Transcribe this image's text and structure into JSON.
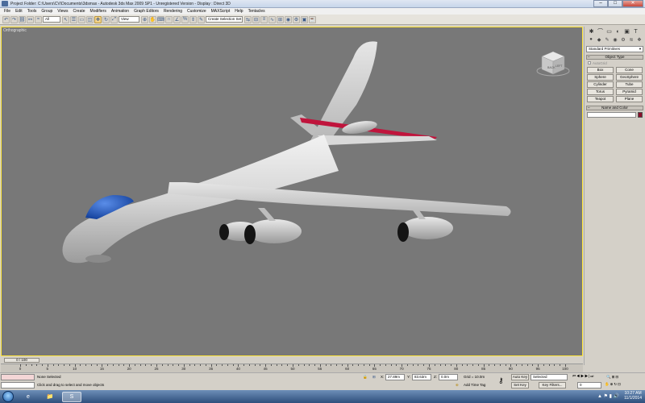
{
  "window": {
    "title": "Project Folder: C:\\Users\\CV\\Documents\\3dsmax - Autodesk 3ds Max 2009 SP1 - Unregistered Version - Display : Direct 3D",
    "buttons": {
      "minimize": "–",
      "maximize": "□",
      "close": "✕"
    }
  },
  "menu": [
    "File",
    "Edit",
    "Tools",
    "Group",
    "Views",
    "Create",
    "Modifiers",
    "Animation",
    "Graph Editors",
    "Rendering",
    "Customize",
    "MAXScript",
    "Help",
    "Tentacles"
  ],
  "toolbar": {
    "selection_filter": "All",
    "reference_coord": "View",
    "named_selection": "Create Selection Set"
  },
  "viewport": {
    "label": "Orthographic",
    "viewcube_front": "BACK",
    "viewcube_side": "LEFT"
  },
  "command_panel": {
    "tabs": [
      "✱",
      "⌒",
      "▭",
      "◐",
      "▣",
      "T"
    ],
    "category_icons": [
      "●",
      "◆",
      "✎",
      "◉",
      "⚙",
      "≋",
      "❖"
    ],
    "category_dropdown": "Standard Primitives",
    "object_type_header": "Object Type",
    "autogrid_label": "AutoGrid",
    "object_buttons": [
      "Box",
      "Cone",
      "Sphere",
      "GeoSphere",
      "Cylinder",
      "Tube",
      "Torus",
      "Pyramid",
      "Teapot",
      "Plane"
    ],
    "name_color_header": "Name and Color",
    "name_value": "",
    "object_color": "#8a0f2a"
  },
  "timeline": {
    "slider_label": "0 / 100",
    "ticks": [
      "0",
      "5",
      "10",
      "15",
      "20",
      "25",
      "30",
      "35",
      "40",
      "45",
      "50",
      "55",
      "60",
      "65",
      "70",
      "75",
      "80",
      "85",
      "90",
      "95",
      "100"
    ]
  },
  "status": {
    "selection": "None Selected",
    "prompt": "Click and drag to select and move objects",
    "x_label": "X:",
    "x_value": "27.89m",
    "y_label": "Y:",
    "y_value": "83.63m",
    "z_label": "Z:",
    "z_value": "0.0m",
    "grid": "Grid = 10.0m",
    "add_time_tag": "Add Time Tag",
    "auto_key": "Auto Key",
    "auto_key_mode": "Selected",
    "set_key": "Set Key",
    "key_filters": "Key Filters...",
    "frame": "0"
  },
  "taskbar": {
    "items": [
      "e",
      "📁",
      "S"
    ],
    "time": "10:27 AM",
    "date": "11/1/2014"
  },
  "colors": {
    "viewport_bg": "#787878",
    "viewport_border": "#ffe63a",
    "tail_stripe": "#c0143c",
    "cockpit": "#1f5fc7"
  }
}
